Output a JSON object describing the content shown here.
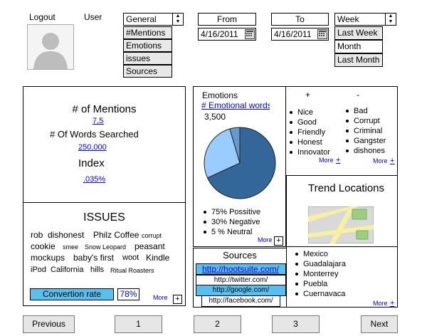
{
  "header": {
    "logout": "Logout",
    "user": "User",
    "filter_select": "General",
    "filter_options": [
      "#Mentions",
      "Emotions",
      "issues",
      "Sources"
    ],
    "from_label": "From",
    "from_date": "4/16/2011",
    "to_label": "To",
    "to_date": "4/16/2011",
    "period_select": "Week",
    "period_options": [
      "Last Week",
      "Month",
      "Last Month"
    ]
  },
  "mentions": {
    "title": "# of Mentions",
    "mentions_value": "7,586",
    "words_label": "# Of Words Searched",
    "words_value": "250,000",
    "index_label": "Index",
    "index_value": ".035%"
  },
  "issues": {
    "title": "ISSUES",
    "row1": [
      "rob",
      "dishonest",
      "Philz Coffee",
      "corrupt"
    ],
    "row2": [
      "cookie",
      "smee",
      "Snow Leopard",
      "peasant"
    ],
    "row3": [
      "mockups",
      "baby's first",
      "woot",
      "Kindle"
    ],
    "row4": [
      "iPod",
      "California",
      "hills",
      "Ritual Roasters"
    ],
    "conversion_label": "Convertion rate",
    "conversion_value": "78%",
    "more": "More",
    "plus": "+"
  },
  "emotions": {
    "title": "Emotions",
    "link": "# Emotional words",
    "count": "3,500",
    "legend": [
      "75% Possitive",
      "30% Negative",
      "5 % Neutral"
    ],
    "more": "More",
    "plus": "+"
  },
  "chart_data": {
    "type": "pie",
    "title": "",
    "slices": [
      {
        "label": "Possitive",
        "value": 75,
        "color": "#336699"
      },
      {
        "label": "Negative",
        "value": 30,
        "color": "#99ccff"
      },
      {
        "label": "Neutral",
        "value": 5,
        "color": "#6699cc"
      }
    ]
  },
  "sources": {
    "title": "Sources",
    "items": [
      "http://hootsuite.com/",
      "http://twitter.com/",
      "http://google.com/",
      "http://facebook.com/"
    ]
  },
  "sentiment_words": {
    "positive_header": "+",
    "negative_header": "-",
    "positive": [
      "Nice",
      "Good",
      "Friendly",
      "Honest",
      "Innovator"
    ],
    "negative": [
      "Bad",
      "Corrupt",
      "Criminal",
      "Gangster",
      "dishones"
    ],
    "more": "More",
    "plus": "+"
  },
  "trends": {
    "title": "Trend Locations",
    "locations": [
      "Mexico",
      "Guadalajara",
      "Monterrey",
      "Puebla",
      "Cuernavaca"
    ],
    "more": "More",
    "plus": "+"
  },
  "pagination": {
    "previous": "Previous",
    "pages": [
      "1",
      "2",
      "3"
    ],
    "next": "Next"
  },
  "colors": {
    "highlight": "#56c1f0",
    "pie_dark": "#336699",
    "pie_light": "#99ccff",
    "pie_mid": "#6699cc"
  }
}
